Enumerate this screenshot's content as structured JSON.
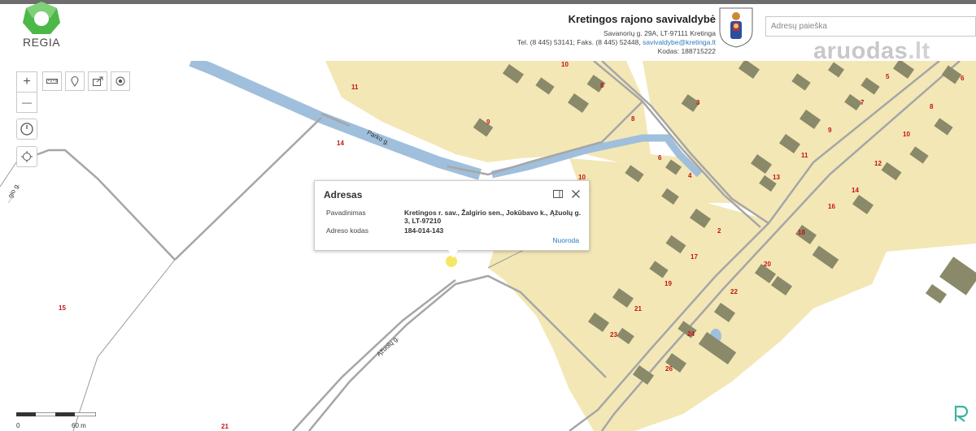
{
  "header": {
    "logo_text": "REGIA",
    "municipality_name": "Kretingos rajono savivaldybė",
    "address_line": "Savanorių g. 29A, LT-97111 Kretinga",
    "contact_prefix": "Tel. (8 445) 53141; Faks. (8 445) 52448,",
    "email": "savivaldybe@kretinga.lt",
    "code_line": "Kodas: 188715222",
    "search_placeholder": "Adresų paieška",
    "brand": "aruodas",
    "brand_tld": ".lt"
  },
  "toolbar": {
    "zoom_in": "+",
    "zoom_out": "—"
  },
  "popup": {
    "title": "Adresas",
    "name_label": "Pavadinimas",
    "name_value": "Kretingos r. sav., Žalgirio sen., Jokūbavo k., Ąžuolų g. 3, LT-97210",
    "code_label": "Adreso kodas",
    "code_value": "184-014-143",
    "link": "Nuoroda"
  },
  "roads": {
    "parko": "Parko g.",
    "azuolu": "Ąžuolų g.",
    "left": "...gio g."
  },
  "parcels": {
    "p11": "11",
    "p14": "14",
    "p15": "15",
    "p21b": "21",
    "p10a": "10",
    "p8a": "8",
    "p9a": "9",
    "p8b": "8",
    "p10b": "10",
    "p6a": "6",
    "p4a": "4",
    "p2a": "2",
    "p17": "17",
    "p19": "19",
    "p21a": "21",
    "p23": "23",
    "p3": "3",
    "p5": "5",
    "p7": "7",
    "p9b": "9",
    "p11b": "11",
    "p13": "13",
    "p6b": "6",
    "p8c": "8",
    "p10c": "10",
    "p12": "12",
    "p14b": "14",
    "p16": "16",
    "p18": "18",
    "p20": "20",
    "p22": "22",
    "p24": "24",
    "p26": "26"
  },
  "scale": {
    "start": "0",
    "end": "60 m"
  },
  "colors": {
    "parcel_fill": "#f3e7b6",
    "building": "#8a8a6a",
    "water": "#9fbfdc",
    "road_line": "#8c8c8c",
    "label_red": "#c41414",
    "link_blue": "#2a7bbf"
  }
}
